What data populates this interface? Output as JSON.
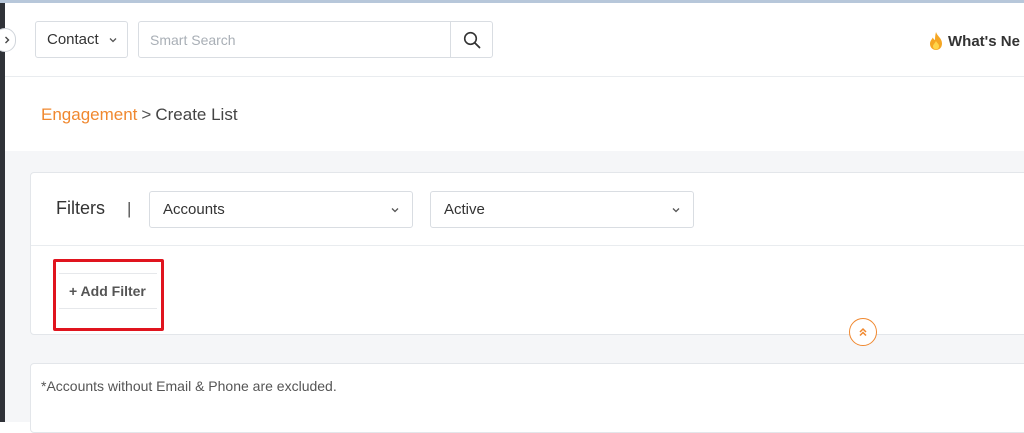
{
  "header": {
    "module_select": "Contact",
    "search_placeholder": "Smart Search",
    "whats_new": "What's Ne"
  },
  "breadcrumb": {
    "parent": "Engagement",
    "separator": ">",
    "current": "Create List"
  },
  "filters": {
    "title": "Filters",
    "divider": "|",
    "type_select": "Accounts",
    "status_select": "Active",
    "add_filter": "+ Add Filter"
  },
  "note": "*Accounts without Email & Phone are excluded.",
  "icons": {
    "collapse_sidebar": "chevron-right-icon",
    "module_dropdown": "chevron-down-icon",
    "search": "search-icon",
    "whats_new": "fire-icon",
    "collapse_filters": "double-chevron-up-icon"
  },
  "colors": {
    "accent": "#f0882f",
    "highlight": "#e0141e",
    "sidebar": "#2f3238"
  }
}
